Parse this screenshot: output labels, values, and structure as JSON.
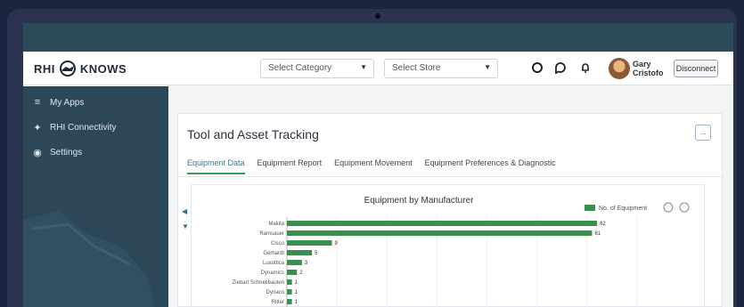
{
  "header": {
    "logo_left": "RHI",
    "logo_right": "KNOWS",
    "select1": "Select Category",
    "select2": "Select Store",
    "user_name_line1": "Gary",
    "user_name_line2": "Cristofo",
    "logout_label": "Disconnect"
  },
  "sidebar": {
    "items": [
      {
        "icon": "list-icon",
        "label": "My Apps"
      },
      {
        "icon": "network-icon",
        "label": "RHI Connectivity"
      },
      {
        "icon": "settings-icon",
        "label": "Settings"
      }
    ]
  },
  "card": {
    "title": "Tool and Asset Tracking",
    "button_label": "..."
  },
  "tabs": [
    {
      "label": "Equipment Data",
      "active": true
    },
    {
      "label": "Equipment Report",
      "active": false
    },
    {
      "label": "Equipment Movement",
      "active": false
    },
    {
      "label": "Equipment Preferences & Diagnostic",
      "active": false
    }
  ],
  "chart_data": {
    "type": "bar",
    "orientation": "horizontal",
    "title": "Equipment by Manufacturer",
    "legend": [
      "No. of Equipment"
    ],
    "legend_placement": "top-right",
    "color": "#3c8f4f",
    "categories": [
      "Makita",
      "Ramsauer",
      "Cisco",
      "Gerhardt",
      "Luxottica",
      "Dynamics",
      "Ziebart Schnellbauten",
      "Dynaco",
      "Ritter"
    ],
    "values": [
      62,
      61,
      9,
      5,
      3,
      2,
      1,
      1,
      1
    ],
    "value_labels": [
      "62",
      "61",
      "9",
      "5",
      "3",
      "2",
      "1",
      "1",
      "1"
    ],
    "xlim": [
      0,
      70
    ],
    "grid": true
  }
}
